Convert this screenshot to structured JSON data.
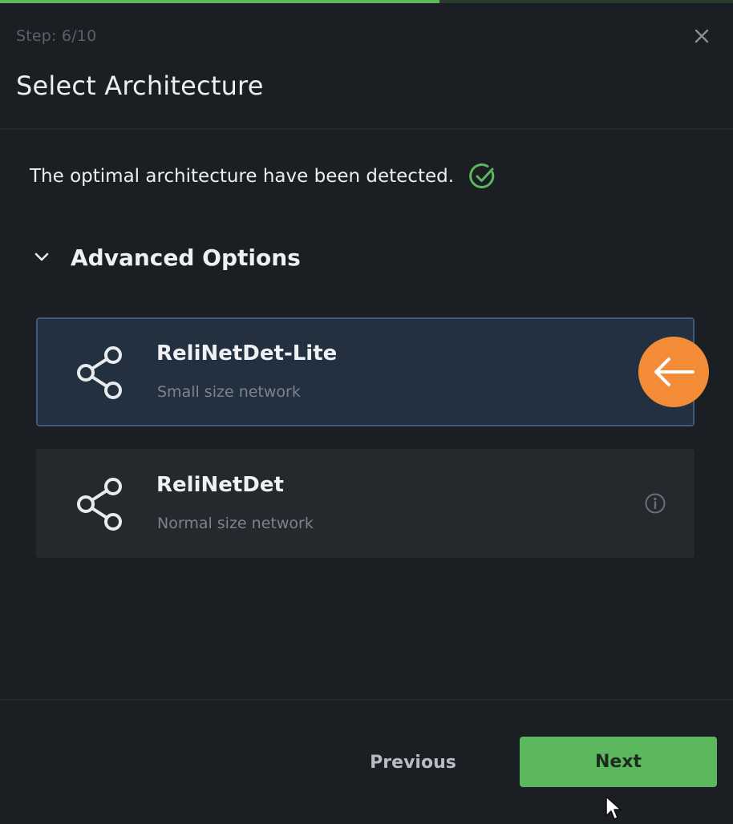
{
  "progress": {
    "fraction": 0.6
  },
  "header": {
    "step": "Step: 6/10",
    "title": "Select Architecture"
  },
  "status": {
    "message": "The optimal architecture have been detected.",
    "icon": "check-circle-icon",
    "color": "#5cb85c"
  },
  "advanced": {
    "label": "Advanced Options",
    "expanded": true
  },
  "architectures": [
    {
      "name": "ReliNetDet-Lite",
      "description": "Small size network",
      "selected": true,
      "icon": "share-icon"
    },
    {
      "name": "ReliNetDet",
      "description": "Normal size network",
      "selected": false,
      "icon": "share-icon"
    }
  ],
  "footer": {
    "previous_label": "Previous",
    "next_label": "Next"
  },
  "colors": {
    "accent": "#5cb85c",
    "selected_bg": "#23303f",
    "selected_border": "#3d5a7c",
    "badge": "#f48c37"
  }
}
